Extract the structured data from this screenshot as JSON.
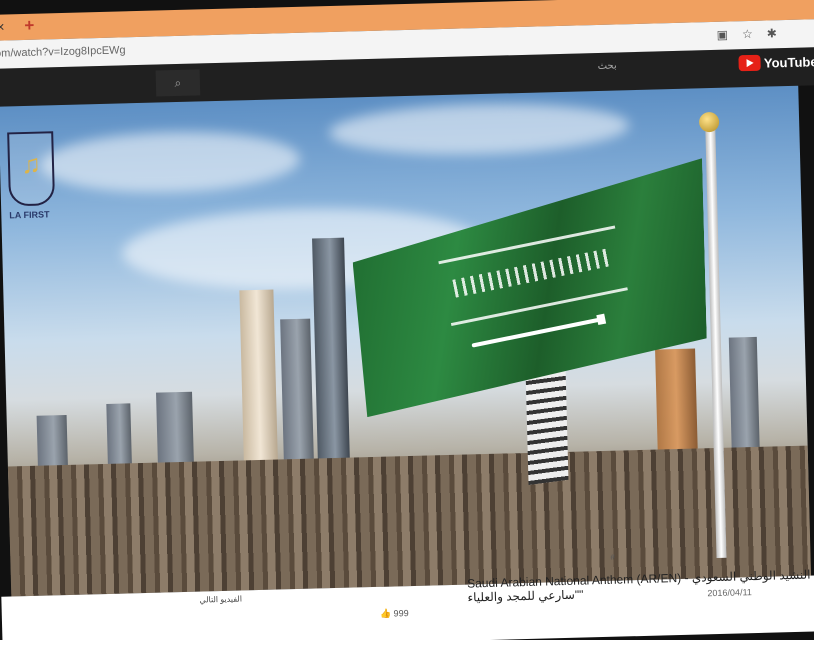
{
  "browser": {
    "tab_close": "×",
    "tab_new": "+",
    "url": "om/watch?v=Izog8IpcEWg"
  },
  "youtube": {
    "search_label": "بحث",
    "logo_text": "YouTube"
  },
  "video": {
    "emblem_text": "LA FIRST",
    "title": "Saudi Arabian National Anthem (AR/EN) - النشيد الوطني السعودي \"سارعي للمجد والعلياء\"",
    "title_short": "Saudi Arabian National Anthem (AR/EN)",
    "date": "2016/04/11",
    "likes": "999",
    "up_next_label": "الفيديو التالي"
  },
  "colors": {
    "tab_accent": "#f0a060",
    "youtube_red": "#e62117",
    "flag_green": "#2d8a42"
  }
}
